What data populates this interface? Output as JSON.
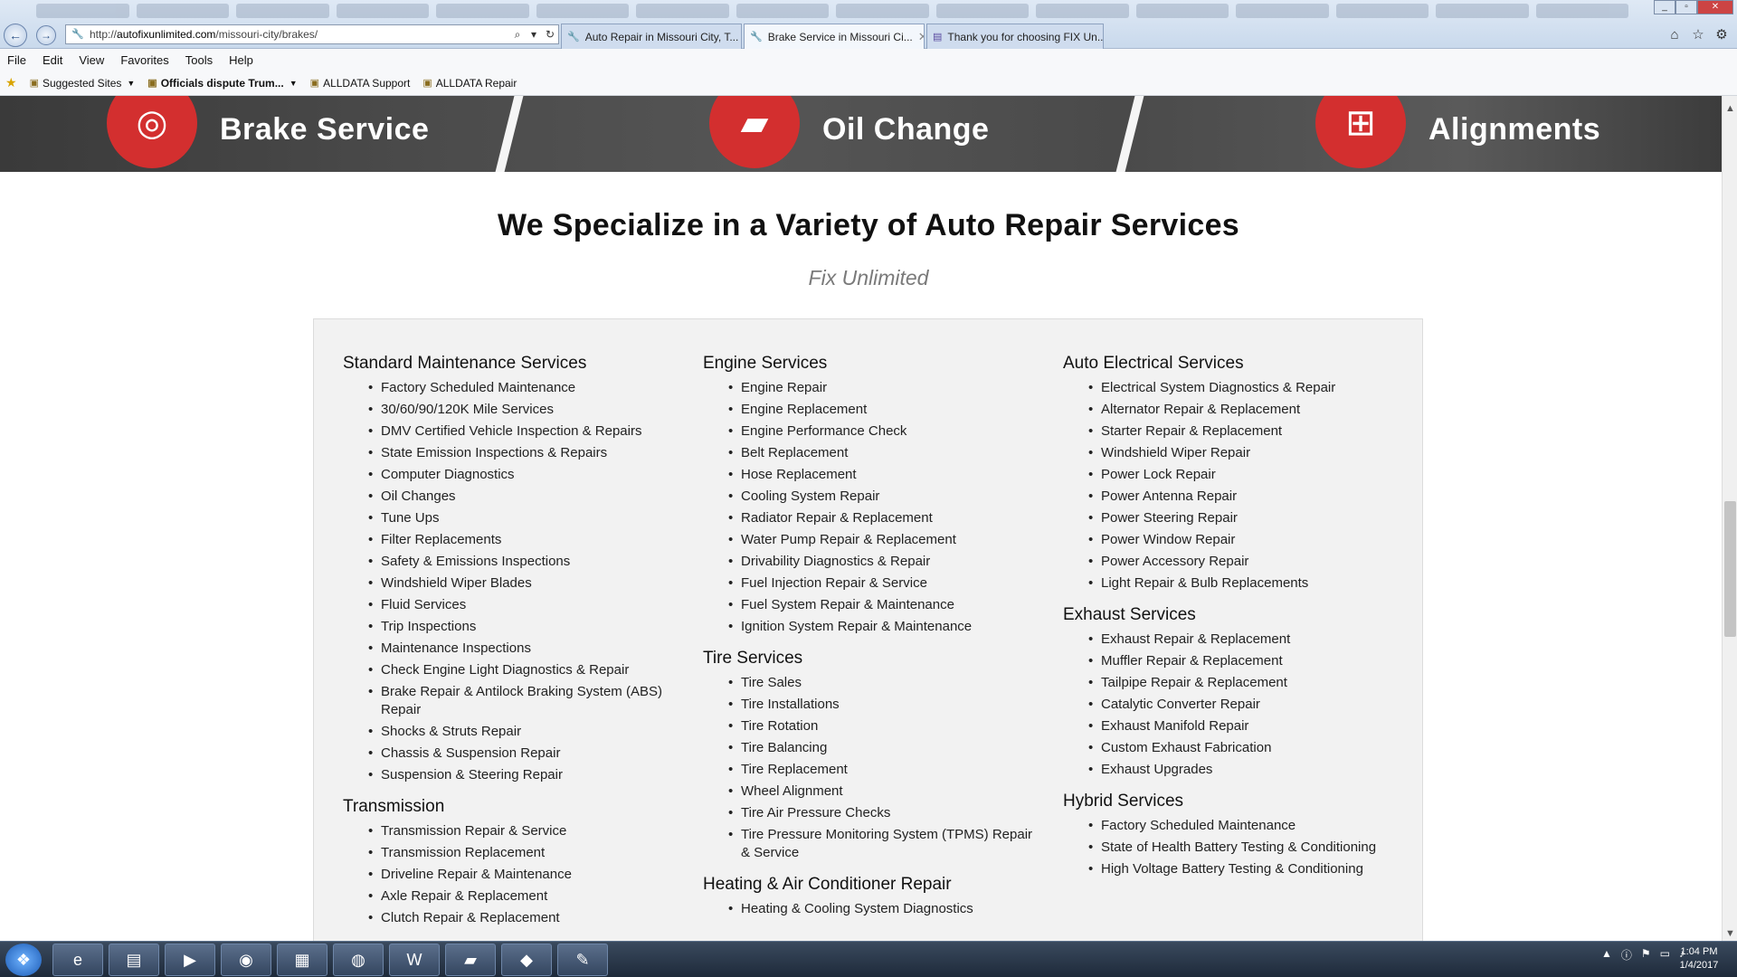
{
  "browser": {
    "url_prefix": "http://",
    "url_domain": "autofixunlimited.com",
    "url_path": "/missouri-city/brakes/",
    "tabs": [
      {
        "title": "Auto Repair in Missouri City, T..."
      },
      {
        "title": "Brake Service in Missouri Ci..."
      },
      {
        "title": "Thank you for choosing FIX Un..."
      }
    ],
    "menu": [
      "File",
      "Edit",
      "View",
      "Favorites",
      "Tools",
      "Help"
    ],
    "favorites": [
      {
        "label": "Suggested Sites"
      },
      {
        "label": "Officials dispute Trum..."
      },
      {
        "label": "ALLDATA Support"
      },
      {
        "label": "ALLDATA Repair"
      }
    ]
  },
  "hero": {
    "items": [
      {
        "label": "Brake Service",
        "icon": "brake-disc-icon"
      },
      {
        "label": "Oil Change",
        "icon": "oil-can-icon"
      },
      {
        "label": "Alignments",
        "icon": "axle-icon"
      }
    ]
  },
  "section": {
    "title": "We Specialize in a Variety of Auto Repair Services",
    "subtitle": "Fix Unlimited"
  },
  "services": {
    "col1": [
      {
        "title": "Standard Maintenance Services",
        "items": [
          "Factory Scheduled Maintenance",
          "30/60/90/120K Mile Services",
          "DMV Certified Vehicle Inspection & Repairs",
          "State Emission Inspections & Repairs",
          "Computer Diagnostics",
          "Oil Changes",
          "Tune Ups",
          "Filter Replacements",
          "Safety & Emissions Inspections",
          "Windshield Wiper Blades",
          "Fluid Services",
          "Trip Inspections",
          "Maintenance Inspections",
          "Check Engine Light Diagnostics & Repair",
          "Brake Repair & Antilock Braking System (ABS) Repair",
          "Shocks & Struts Repair",
          "Chassis & Suspension Repair",
          "Suspension & Steering Repair"
        ]
      },
      {
        "title": "Transmission",
        "items": [
          "Transmission Repair & Service",
          "Transmission Replacement",
          "Driveline Repair & Maintenance",
          "Axle Repair & Replacement",
          "Clutch Repair & Replacement"
        ]
      }
    ],
    "col2": [
      {
        "title": "Engine Services",
        "items": [
          "Engine Repair",
          "Engine Replacement",
          "Engine Performance Check",
          "Belt Replacement",
          "Hose Replacement",
          "Cooling System Repair",
          "Radiator Repair & Replacement",
          "Water Pump Repair & Replacement",
          "Drivability Diagnostics & Repair",
          "Fuel Injection Repair & Service",
          "Fuel System Repair & Maintenance",
          "Ignition System Repair & Maintenance"
        ]
      },
      {
        "title": "Tire Services",
        "items": [
          "Tire Sales",
          "Tire Installations",
          "Tire Rotation",
          "Tire Balancing",
          "Tire Replacement",
          "Wheel Alignment",
          "Tire Air Pressure Checks",
          "Tire Pressure Monitoring System (TPMS) Repair & Service"
        ]
      },
      {
        "title": "Heating & Air Conditioner Repair",
        "items": [
          "Heating & Cooling System Diagnostics"
        ]
      }
    ],
    "col3": [
      {
        "title": "Auto Electrical Services",
        "items": [
          "Electrical System Diagnostics & Repair",
          "Alternator Repair & Replacement",
          "Starter Repair & Replacement",
          "Windshield Wiper Repair",
          "Power Lock Repair",
          "Power Antenna Repair",
          "Power Steering Repair",
          "Power Window Repair",
          "Power Accessory Repair",
          "Light Repair & Bulb Replacements"
        ]
      },
      {
        "title": "Exhaust Services",
        "items": [
          "Exhaust Repair & Replacement",
          "Muffler Repair & Replacement",
          "Tailpipe Repair & Replacement",
          "Catalytic Converter Repair",
          "Exhaust Manifold Repair",
          "Custom Exhaust Fabrication",
          "Exhaust Upgrades"
        ]
      },
      {
        "title": "Hybrid Services",
        "items": [
          "Factory Scheduled Maintenance",
          "State of Health Battery Testing & Conditioning",
          "High Voltage Battery Testing & Conditioning"
        ]
      }
    ]
  },
  "taskbar": {
    "apps": [
      "internet-explorer-icon",
      "file-explorer-icon",
      "media-player-icon",
      "firefox-icon",
      "calculator-icon",
      "chrome-icon",
      "word-icon",
      "folder-icon",
      "git-icon",
      "paint-icon"
    ],
    "time": "1:04 PM",
    "date": "1/4/2017"
  },
  "colors": {
    "accent_red": "#d32f2f",
    "panel_bg": "#f2f2f2"
  }
}
